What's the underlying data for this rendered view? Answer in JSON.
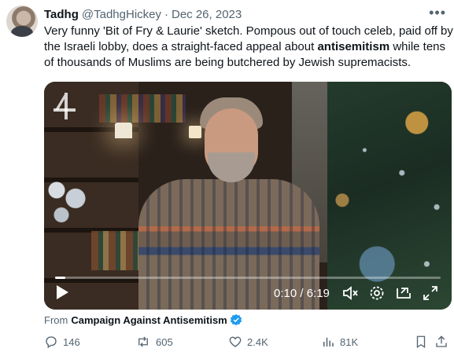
{
  "tweet": {
    "name": "Tadhg",
    "handle": "@TadhgHickey",
    "separator": "·",
    "date": "Dec 26, 2023",
    "text_before": "Very funny 'Bit of Fry & Laurie' sketch. Pompous out of touch celeb, paid off by the Israeli lobby, does a straight-faced appeal about ",
    "text_bold": "antisemitism",
    "text_after": " while tens of thousands of Muslims are being butchered by Jewish supremacists."
  },
  "video": {
    "time": "0:10 / 6:19",
    "progress": 0.027,
    "icons": [
      "channel4-logo",
      "play-icon",
      "mute-icon",
      "settings-icon",
      "pip-icon",
      "fullscreen-icon"
    ]
  },
  "source": {
    "prefix": "From",
    "name": "Campaign Against Antisemitism",
    "verified_color": "#1d9bf0"
  },
  "actions": {
    "replies": "146",
    "reposts": "605",
    "likes": "2.4K",
    "views": "81K"
  },
  "colors": {
    "text": "#0f1419",
    "muted": "#536471"
  }
}
